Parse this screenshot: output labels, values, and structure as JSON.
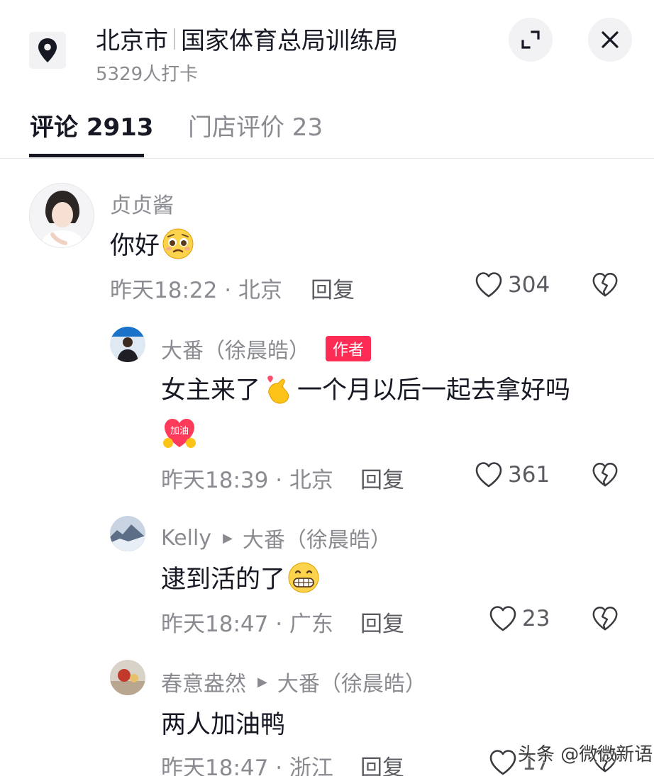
{
  "header": {
    "city": "北京市",
    "place": "国家体育总局训练局",
    "checkins": "5329人打卡",
    "icons": {
      "location": "location-pin-icon",
      "expand": "expand-icon",
      "close": "close-icon"
    }
  },
  "tabs": [
    {
      "label": "评论 2913",
      "active": true
    },
    {
      "label": "门店评价 23",
      "active": false
    }
  ],
  "comments": [
    {
      "user": "贞贞酱",
      "text": "你好",
      "emoji": "pleading-face-emoji",
      "meta": "昨天18:22 · 北京",
      "reply": "回复",
      "likes": "304"
    },
    {
      "user": "大番（徐晨皓）",
      "badge": "作者",
      "text": "女主来了",
      "emoji1": "finger-heart-emoji",
      "text2": "一个月以后一起去拿好吗",
      "emoji2": "jiayou-emoji",
      "emoji2_label": "加油",
      "meta": "昨天18:39 · 北京",
      "reply": "回复",
      "likes": "361"
    },
    {
      "user": "Kelly",
      "reply_to": "大番（徐晨皓）",
      "text": "逮到活的了",
      "emoji": "grinning-emoji",
      "meta": "昨天18:47 · 广东",
      "reply": "回复",
      "likes": "23"
    },
    {
      "user": "春意盎然",
      "reply_to": "大番（徐晨皓）",
      "text": "两人加油鸭",
      "meta": "昨天18:47 · 浙江",
      "reply": "回复",
      "likes": "17"
    }
  ],
  "watermark": "头条 @微微新语",
  "colors": {
    "accent": "#fe2c55",
    "text": "#161823",
    "muted": "#8a8b91"
  }
}
